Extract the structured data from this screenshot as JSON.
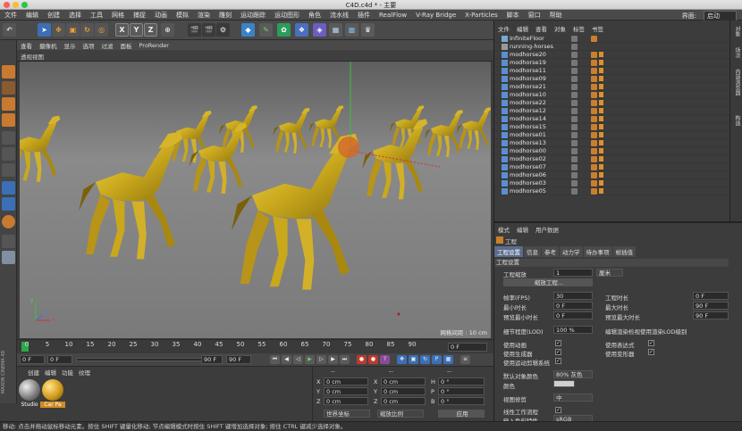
{
  "window": {
    "title": "C4D.c4d * - 主要"
  },
  "menubar": {
    "items": [
      "文件",
      "编辑",
      "创建",
      "选择",
      "工具",
      "网格",
      "捕捉",
      "动画",
      "模拟",
      "渲染",
      "雕刻",
      "运动跟踪",
      "运动图形",
      "角色",
      "流水线",
      "插件",
      "RealFlow",
      "V-Ray Bridge",
      "X-Particles",
      "脚本",
      "窗口",
      "帮助"
    ],
    "layout_label": "界面:",
    "layout_value": "启动"
  },
  "viewport": {
    "menu": [
      "查看",
      "摄像机",
      "显示",
      "选项",
      "过滤",
      "面板",
      "ProRender"
    ],
    "title": "透视视图",
    "grid_spacing": "网格间距 : 10 cm",
    "axis": {
      "x": "x",
      "y": "y",
      "z": "z"
    }
  },
  "timeline": {
    "ticks": [
      "0",
      "5",
      "10",
      "15",
      "20",
      "25",
      "30",
      "35",
      "40",
      "45",
      "50",
      "55",
      "60",
      "65",
      "70",
      "75",
      "80",
      "85",
      "90"
    ],
    "frame_field": "0 F"
  },
  "transport": {
    "start": "0 F",
    "current": "0 F",
    "end": "90 F",
    "end2": "90 F"
  },
  "material_panel": {
    "menu": [
      "创建",
      "编辑",
      "功能",
      "纹理"
    ],
    "materials": [
      {
        "name": "Studio",
        "color": "#9a9a9a"
      },
      {
        "name": "Car Pa",
        "color": "#d39a1e"
      }
    ],
    "brand1": "MAXON",
    "brand2": "CINEMA 4D"
  },
  "coord_panel": {
    "header_dash": "--",
    "rows": [
      {
        "a": "X",
        "v1": "0 cm",
        "b": "X",
        "v2": "0 cm",
        "c": "H",
        "v3": "0 °"
      },
      {
        "a": "Y",
        "v1": "0 cm",
        "b": "Y",
        "v2": "0 cm",
        "c": "P",
        "v3": "0 °"
      },
      {
        "a": "Z",
        "v1": "0 cm",
        "b": "Z",
        "v2": "0 cm",
        "c": "B",
        "v3": "0 °"
      }
    ],
    "dropdown1": "世界坐标",
    "dropdown2": "缩放比例",
    "apply": "应用"
  },
  "object_manager": {
    "menu": [
      "文件",
      "编辑",
      "查看",
      "对象",
      "标签",
      "书签"
    ],
    "objects": [
      "InfiniteFloor",
      "running-horses",
      "modhorse20",
      "modhorse19",
      "modhorse11",
      "modhorse09",
      "modhorse21",
      "modhorse10",
      "modhorse22",
      "modhorse12",
      "modhorse14",
      "modhorse15",
      "modhorse01",
      "modhorse13",
      "modhorse00",
      "modhorse02",
      "modhorse07",
      "modhorse06",
      "modhorse03",
      "modhorse05"
    ],
    "side_tabs": [
      "对象",
      "场次",
      "内容浏览器",
      "构造"
    ]
  },
  "attributes": {
    "menu": [
      "模式",
      "编辑",
      "用户数据"
    ],
    "title": "工程",
    "tabs": [
      "工程设置",
      "信息",
      "参考",
      "动力学",
      "待办事项",
      "帧插值"
    ],
    "section": "工程设置",
    "scale_label": "工程缩放",
    "scale_value": "1",
    "scale_unit": "厘米",
    "scale_button": "缩放工程...",
    "left_props": [
      {
        "label": "帧率(FPS)",
        "value": "30"
      },
      {
        "label": "最小时长",
        "value": "0 F"
      },
      {
        "label": "预览最小时长",
        "value": "0 F"
      }
    ],
    "right_props": [
      {
        "label": "工程时长",
        "value": "0 F"
      },
      {
        "label": "最大时长",
        "value": "90 F"
      },
      {
        "label": "预览最大时长",
        "value": "90 F"
      }
    ],
    "lod_label": "细节程度(LOD)",
    "lod_value": "100 %",
    "lod_render": "编辑渲染检视使用渲染LOD级别",
    "checks_left": [
      "使用动画",
      "使用生成器",
      "使用运动剪辑系统"
    ],
    "checks_right": [
      "使用表达式",
      "使用变形器"
    ],
    "default_color_label": "默认对象颜色",
    "default_color_value": "80% 灰色",
    "color_label": "颜色",
    "view_clip_label": "视图修剪",
    "view_clip_value": "中",
    "linear_label": "线性工作流程",
    "input_color_label": "输入色彩特性",
    "input_color_value": "sRGB"
  },
  "status": {
    "text": "移动: 点击并拖动鼠标移动元素。按住 SHIFT 键量化移动; 节点编辑模式时按住 SHIFT 键增加选择对象; 按住 CTRL 键减少选择对象。"
  }
}
